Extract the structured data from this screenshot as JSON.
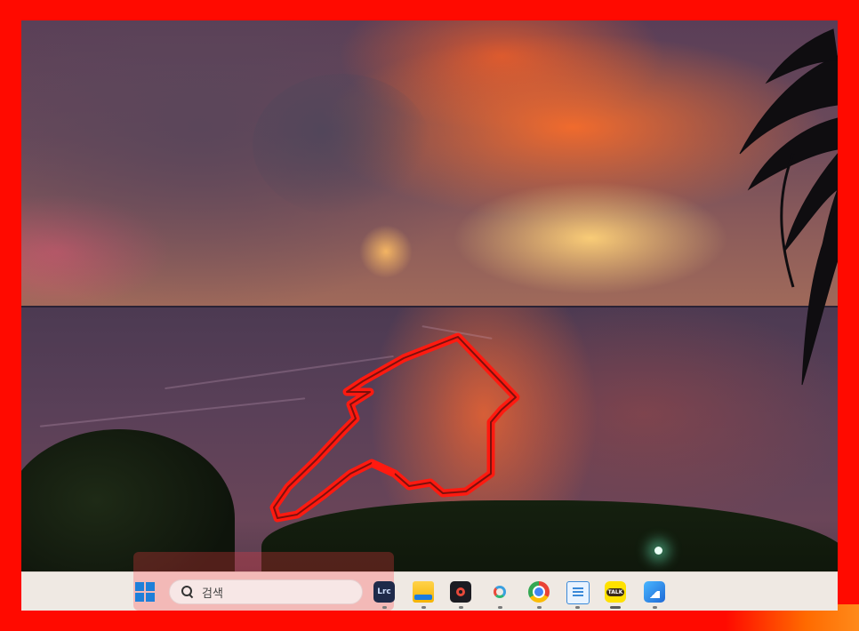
{
  "colors": {
    "frame_border": "#ff0a00",
    "pointer_outline": "#ff1a10",
    "taskbar_bg": "#efe9e3",
    "taskbar_highlight": "#ff3c46"
  },
  "wallpaper": {
    "scene": "sunset-over-ocean-with-palm-trees",
    "annotation": "hand-pointer-outline"
  },
  "taskbar": {
    "start_icon": "windows-logo-icon",
    "search": {
      "icon": "search-icon",
      "placeholder": "검색"
    },
    "apps": [
      {
        "name": "lightroom-classic-icon",
        "label": "Lrc",
        "running": true
      },
      {
        "name": "file-explorer-icon",
        "running": true
      },
      {
        "name": "dark-app-icon",
        "running": true
      },
      {
        "name": "hub-app-icon",
        "running": true
      },
      {
        "name": "chrome-icon",
        "running": true
      },
      {
        "name": "notepad-icon",
        "running": true
      },
      {
        "name": "kakaotalk-icon",
        "label": "TALK",
        "running": true,
        "active": true
      },
      {
        "name": "photos-icon",
        "running": true
      }
    ]
  }
}
